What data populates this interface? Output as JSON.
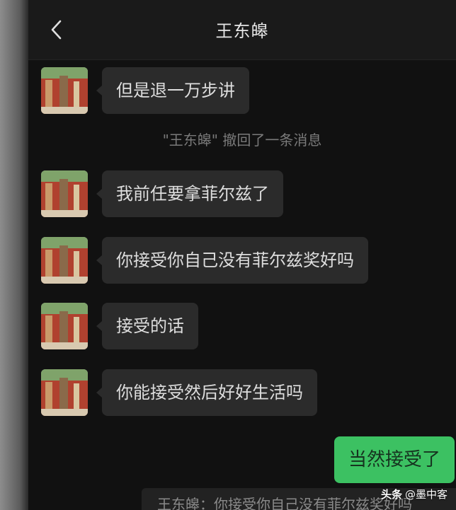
{
  "header": {
    "title": "王东皞",
    "back_icon": "chevron-left-icon"
  },
  "messages": [
    {
      "direction": "incoming",
      "text": "但是退一万步讲"
    },
    {
      "direction": "incoming",
      "text": "我前任要拿菲尔兹了"
    },
    {
      "direction": "incoming",
      "text": "你接受你自己没有菲尔兹奖好吗"
    },
    {
      "direction": "incoming",
      "text": "接受的话"
    },
    {
      "direction": "incoming",
      "text": "你能接受然后好好生活吗"
    },
    {
      "direction": "outgoing",
      "text": "当然接受了"
    }
  ],
  "recall_notice": "\"王东皞\" 撤回了一条消息",
  "quote": "王东皞：你接受你自己没有菲尔兹奖好吗",
  "watermark": {
    "brand": "头条",
    "handle": "@墨中客"
  },
  "colors": {
    "background": "#121212",
    "incoming_bubble": "#2b2b2b",
    "outgoing_bubble": "#3cc162"
  }
}
